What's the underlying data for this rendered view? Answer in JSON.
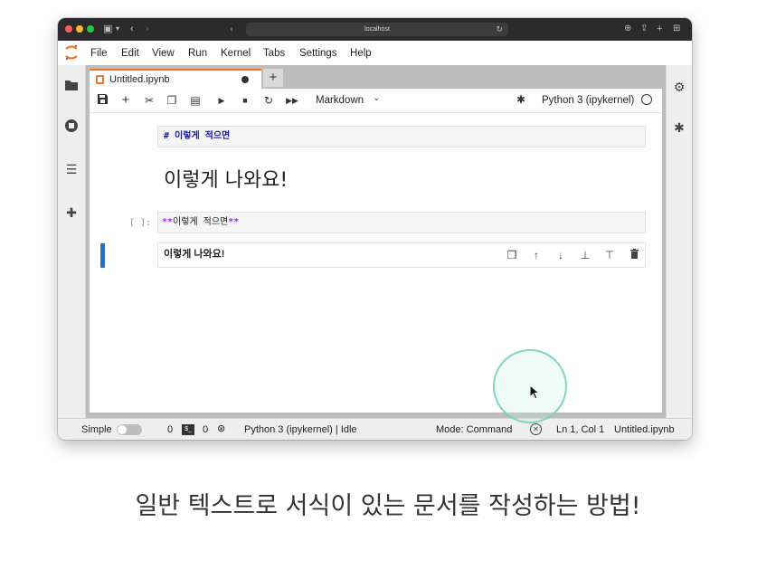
{
  "browser": {
    "url": "localhost"
  },
  "menubar": {
    "items": [
      "File",
      "Edit",
      "View",
      "Run",
      "Kernel",
      "Tabs",
      "Settings",
      "Help"
    ]
  },
  "tab": {
    "title": "Untitled.ipynb",
    "new_tab_label": "+"
  },
  "toolbar": {
    "cell_type": "Markdown",
    "kernel_name": "Python 3 (ipykernel)"
  },
  "cells": [
    {
      "type": "markdown-source",
      "source": "# 이렇게 적으면"
    },
    {
      "type": "markdown-rendered",
      "text": "이렇게 나와요!"
    },
    {
      "type": "markdown-source",
      "prompt": "[ ]:",
      "marker_open": "**",
      "text": "이렇게 적으면",
      "marker_close": "**"
    },
    {
      "type": "markdown-rendered-active",
      "text": "이렇게 나와요!"
    }
  ],
  "statusbar": {
    "mode_label": "Simple",
    "terminals_count": "0",
    "terminal_icon_text": "$_",
    "kernels_count": "0",
    "kernel_status": "Python 3 (ipykernel) | Idle",
    "command_mode": "Mode: Command",
    "cursor_position": "Ln 1, Col 1",
    "file_name": "Untitled.ipynb"
  },
  "caption": "일반 텍스트로 서식이 있는 문서를 작성하는 방법!",
  "colors": {
    "accent_orange": "#f37726",
    "active_cell_blue": "#1976d2",
    "markdown_marker": "#aa22ff",
    "cursor_ring": "#78d2b4"
  }
}
